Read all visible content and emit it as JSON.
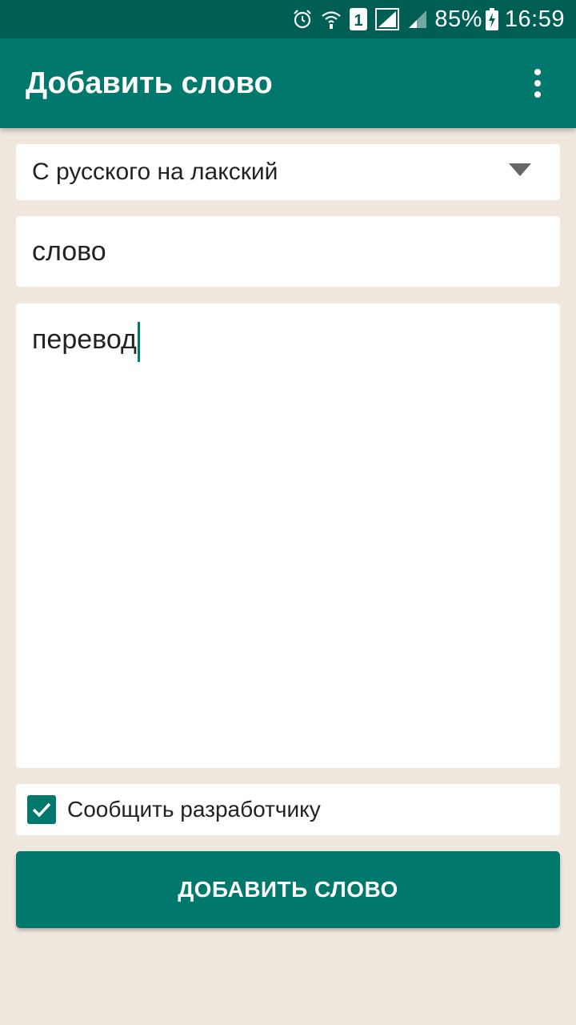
{
  "status_bar": {
    "battery": "85%",
    "time": "16:59",
    "sim_slot": "1",
    "icons": [
      "alarm-icon",
      "wifi-icon",
      "sim-1-icon",
      "signal-icon",
      "signal-weak-icon",
      "battery-charging-icon"
    ]
  },
  "app_bar": {
    "title": "Добавить слово",
    "menu_icon": "overflow-menu-icon"
  },
  "form": {
    "direction_selected": "С русского на лакский",
    "word_value": "слово",
    "translation_value": "перевод",
    "report_label": "Сообщить разработчику",
    "report_checked": true,
    "submit_label": "ДОБАВИТЬ СЛОВО"
  },
  "colors": {
    "status_bar": "#005f55",
    "primary": "#00786b",
    "background": "#f0e7de"
  }
}
